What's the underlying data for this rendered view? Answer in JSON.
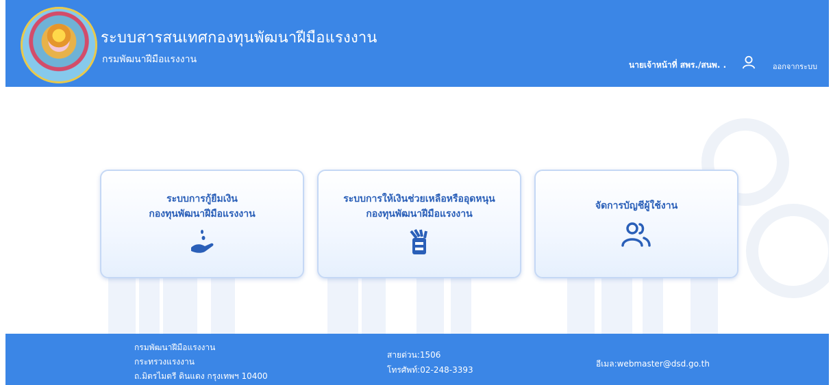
{
  "header": {
    "title": "ระบบสารสนเทศกองทุนพัฒนาฝีมือแรงงาน",
    "subtitle": "กรมพัฒนาฝีมือแรงงาน",
    "user_name": "นายเจ้าหน้าที่ สพร./สนพ. .",
    "logout_label": "ออกจากระบบ",
    "icons": {
      "user": "user-icon",
      "logo": "dsd-seal-logo"
    }
  },
  "cards": [
    {
      "line1": "ระบบการกู้ยืมเงิน",
      "line2": "กองทุนพัฒนาฝีมือแรงงาน",
      "icon": "coin-hand-icon"
    },
    {
      "line1": "ระบบการให้เงินช่วยเหลือหรืออุดหนุน",
      "line2": "กองทุนพัฒนาฝีมือแรงงาน",
      "icon": "money-bundle-icon"
    },
    {
      "line1": "จัดการบัญชีผู้ใช้งาน",
      "icon": "users-icon"
    }
  ],
  "footer": {
    "org_line1": "กรมพัฒนาฝีมือแรงงาน",
    "org_line2": "กระทรวงแรงงาน",
    "org_line3": "ถ.มิตรไมตรี ดินแดง กรุงเทพฯ 10400",
    "hotline": "สายด่วน:1506",
    "phone": "โทรศัพท์:02-248-3393",
    "email": "อีเมล:webmaster@dsd.go.th"
  },
  "colors": {
    "primary": "#3b86e6",
    "card_text": "#2a5fb8",
    "card_border": "#c5d8f5"
  }
}
